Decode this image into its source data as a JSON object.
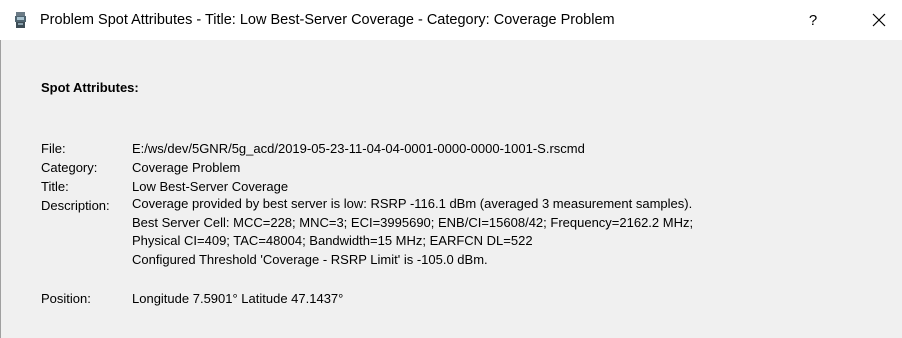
{
  "window": {
    "title": "Problem Spot Attributes - Title: Low Best-Server Coverage - Category: Coverage Problem",
    "help_label": "?",
    "close_label": "✕"
  },
  "section": {
    "heading": "Spot Attributes:"
  },
  "attributes": {
    "file": {
      "label": "File:",
      "value": "E:/ws/dev/5GNR/5g_acd/2019-05-23-11-04-04-0001-0000-0000-1001-S.rscmd"
    },
    "category": {
      "label": "Category:",
      "value": "Coverage Problem"
    },
    "title": {
      "label": "Title:",
      "value": "Low Best-Server Coverage"
    },
    "description": {
      "label": "Description:",
      "lines": [
        "Coverage provided by best server is low: RSRP -116.1 dBm (averaged 3 measurement samples).",
        "Best Server Cell: MCC=228; MNC=3; ECI=3995690; ENB/CI=15608/42; Frequency=2162.2 MHz;",
        "Physical CI=409; TAC=48004; Bandwidth=15 MHz; EARFCN DL=522",
        "Configured Threshold 'Coverage - RSRP Limit' is -105.0 dBm."
      ]
    },
    "position": {
      "label": "Position:",
      "value": "Longitude 7.5901° Latitude 47.1437°"
    }
  }
}
